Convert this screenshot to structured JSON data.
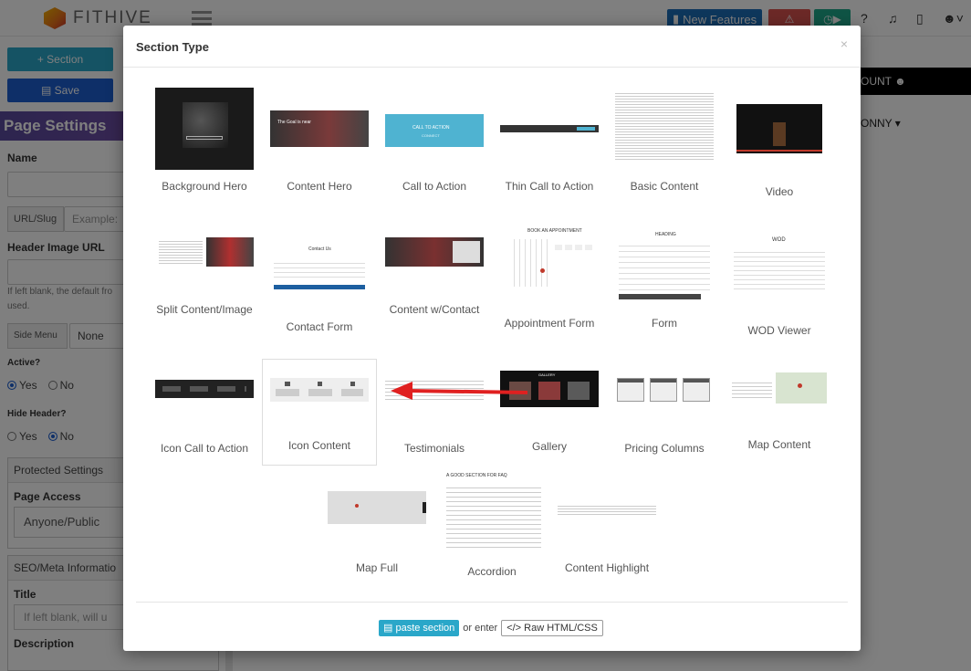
{
  "app": {
    "logo_text": "FITHIVE",
    "new_features_label": "New Features"
  },
  "sidebar": {
    "section_button": "Section",
    "save_button": "Save",
    "page_settings_title": "Page Settings",
    "name_label": "Name",
    "url_slug_addon": "URL/Slug",
    "url_slug_placeholder": "Example: ",
    "header_image_label": "Header Image URL",
    "header_image_note_1": "If left blank, the default fro",
    "header_image_note_2": "used.",
    "side_menu_addon": "Side Menu",
    "side_menu_value": "None",
    "active_label": "Active?",
    "active_yes": "Yes",
    "active_no": "No",
    "hide_header_label": "Hide Header?",
    "hide_yes": "Yes",
    "hide_no": "No",
    "protected_settings": "Protected Settings",
    "page_access_label": "Page Access",
    "page_access_value": "Anyone/Public",
    "seo_title": "SEO/Meta Informatio",
    "title_label": "Title",
    "title_placeholder": "If left blank, will u",
    "description_label": "Description"
  },
  "main": {
    "account_label": "OUNT",
    "user_label": "ONNY"
  },
  "modal": {
    "title": "Section Type",
    "close": "×",
    "selected_tile": "Icon Content",
    "tiles": [
      "Background Hero",
      "Content Hero",
      "Call to Action",
      "Thin Call to Action",
      "Basic Content",
      "Video",
      "Split Content/Image",
      "Contact Form",
      "Content w/Contact",
      "Appointment Form",
      "Form",
      "WOD Viewer",
      "Icon Call to Action",
      "Icon Content",
      "Testimonials",
      "Gallery",
      "Pricing Columns",
      "Map Content",
      "Map Full",
      "Accordion",
      "Content Highlight"
    ],
    "thumb_texts": {
      "content_hero": "The Goal is near",
      "call_to_action": "CALL TO ACTION",
      "call_to_action_sub": "CONNECT",
      "appointment": "BOOK AN APPOINTMENT",
      "form_heading": "HEADING",
      "wod": "WOD",
      "contact_us": "Contact Us",
      "accordion_head": "A GOOD SECTION FOR FAQ",
      "gallery_head": "GALLERY"
    },
    "paste_label": "paste section",
    "or_enter": "or enter",
    "raw_label": "Raw HTML/CSS"
  }
}
